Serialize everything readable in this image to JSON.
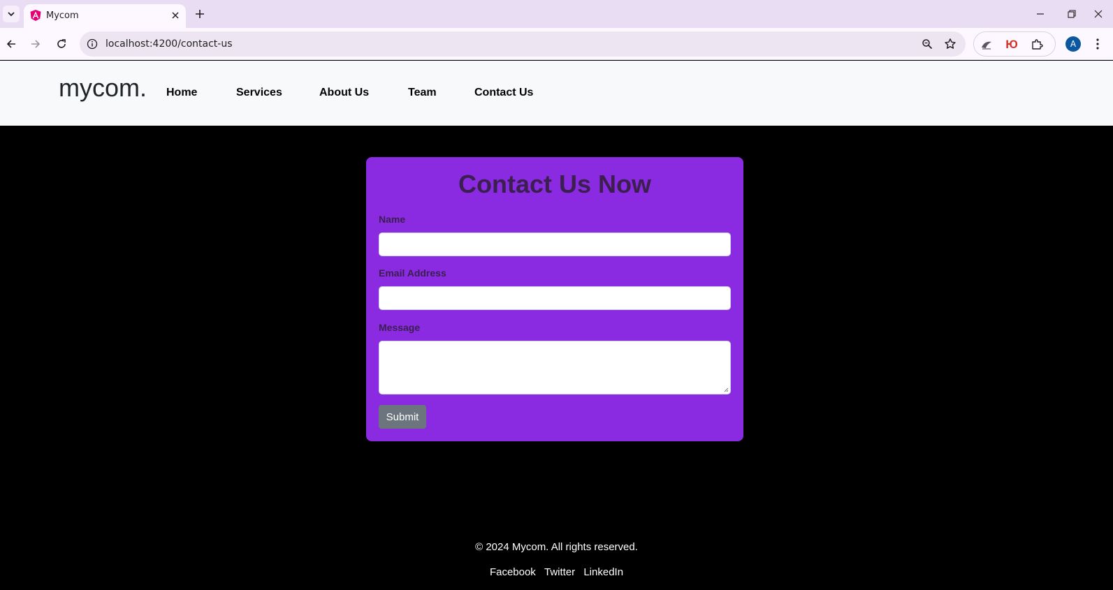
{
  "browser": {
    "tab_title": "Mycom",
    "url": "localhost:4200/contact-us",
    "profile_initial": "A",
    "ext_letter": "Ю"
  },
  "site": {
    "brand": "mycom.",
    "nav": [
      "Home",
      "Services",
      "About Us",
      "Team",
      "Contact Us"
    ]
  },
  "form": {
    "title": "Contact Us Now",
    "name_label": "Name",
    "email_label": "Email Address",
    "message_label": "Message",
    "name_value": "",
    "email_value": "",
    "message_value": "",
    "submit_label": "Submit",
    "accent_color": "#8a2be2"
  },
  "footer": {
    "copyright": "© 2024 Mycom. All rights reserved.",
    "links": [
      "Facebook",
      "Twitter",
      "LinkedIn"
    ]
  }
}
